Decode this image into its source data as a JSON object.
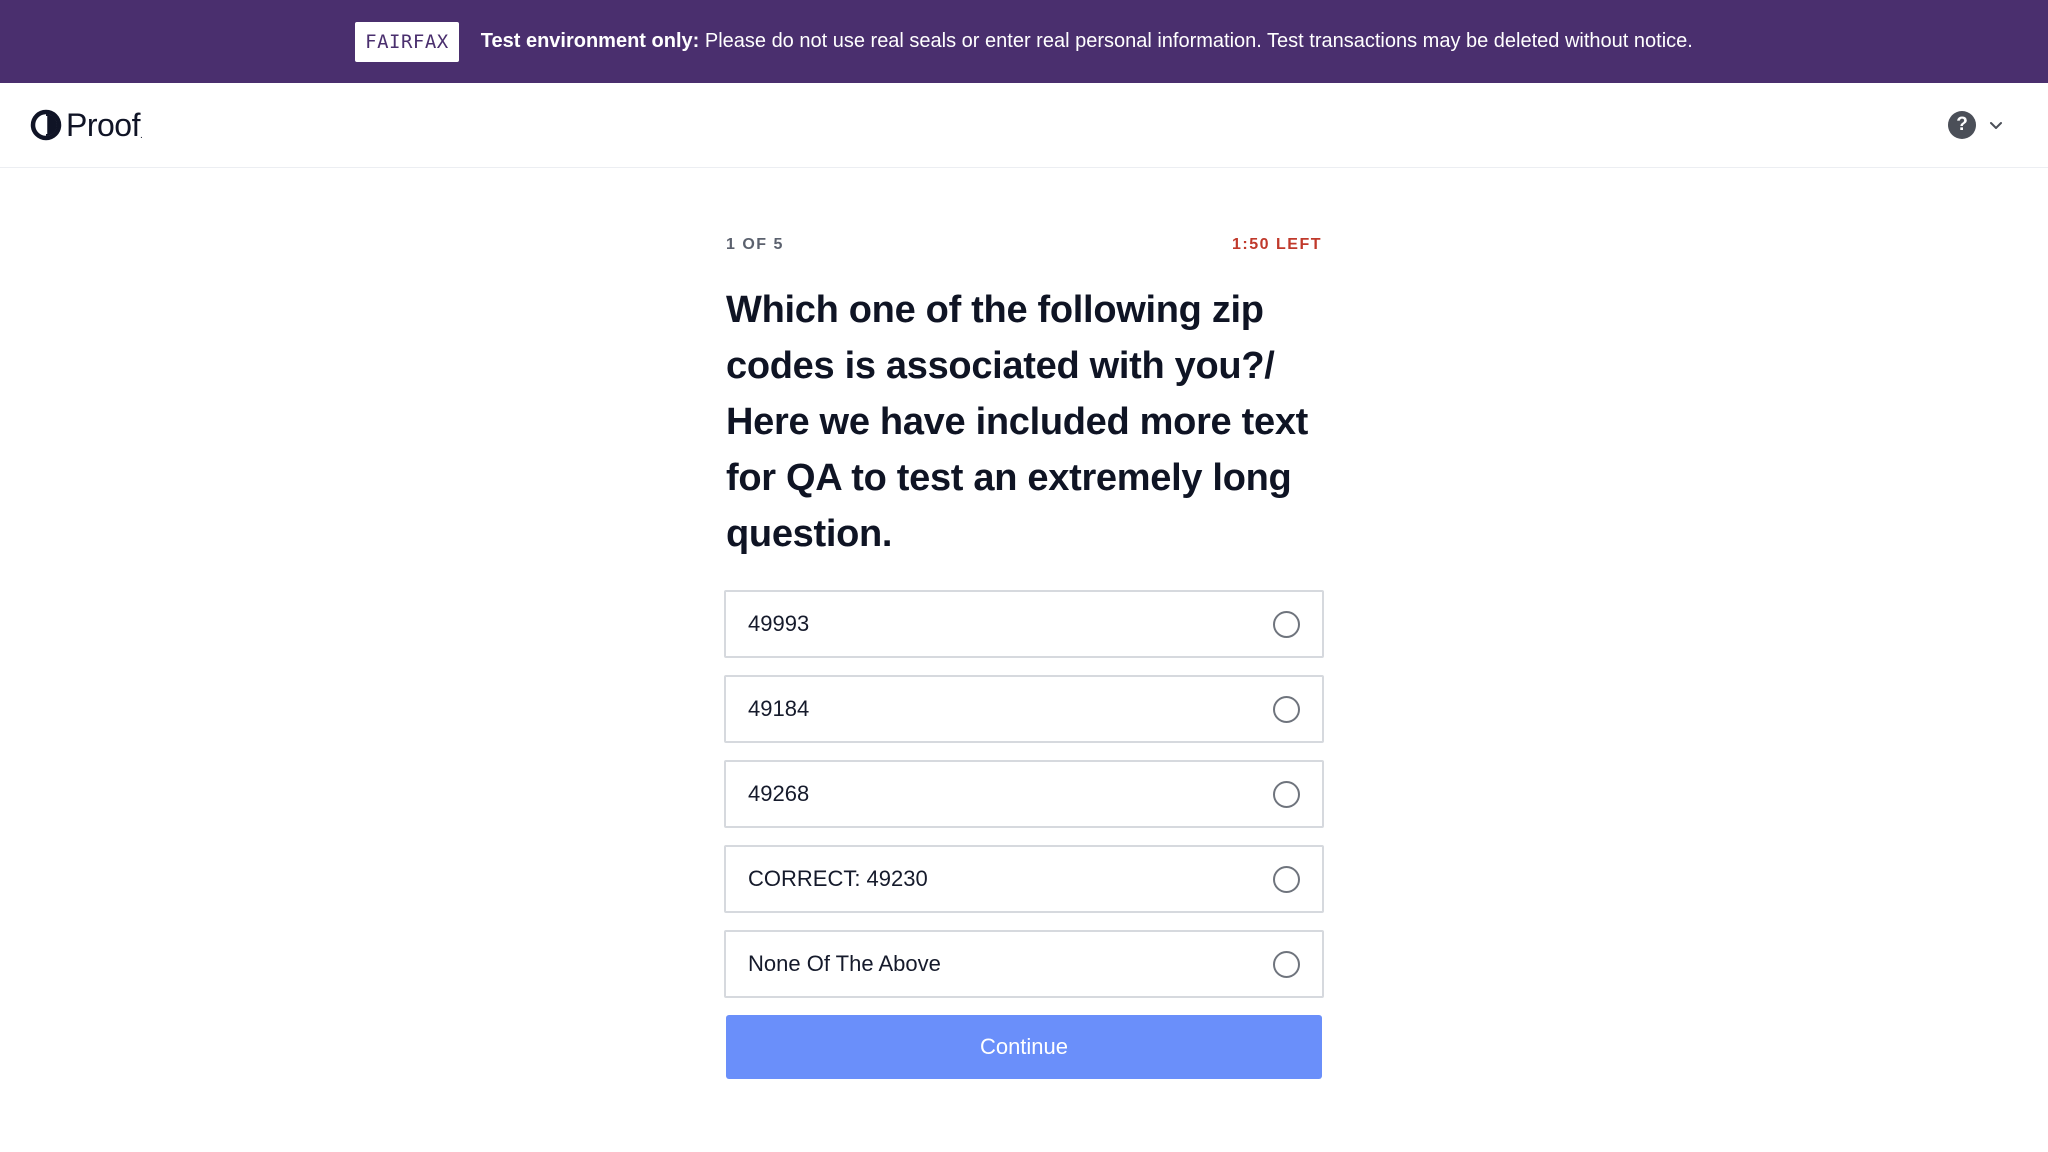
{
  "banner": {
    "badge": "FAIRFAX",
    "bold_text": "Test environment only:",
    "message": " Please do not use real seals or enter real personal information. Test transactions may be deleted without notice."
  },
  "header": {
    "logo_text": "Proof",
    "logo_tm": "."
  },
  "quiz": {
    "progress": "1 OF 5",
    "timer": "1:50 LEFT",
    "question": "Which one of the following zip codes is associated with you?/ Here we have included more text for QA to test an extremely long question.",
    "options": [
      {
        "label": "49993",
        "selected": false
      },
      {
        "label": "49184",
        "selected": false
      },
      {
        "label": "49268",
        "selected": false
      },
      {
        "label": "CORRECT: 49230",
        "selected": false
      },
      {
        "label": "None Of The Above",
        "selected": false
      }
    ],
    "continue_label": "Continue"
  },
  "colors": {
    "banner_bg": "#4a2f6e",
    "timer": "#c0392b",
    "button_bg": "#6a8ffa"
  },
  "icons": {
    "help": "help-circle-icon",
    "chevron": "chevron-down-icon",
    "logo": "proof-logo-icon"
  }
}
